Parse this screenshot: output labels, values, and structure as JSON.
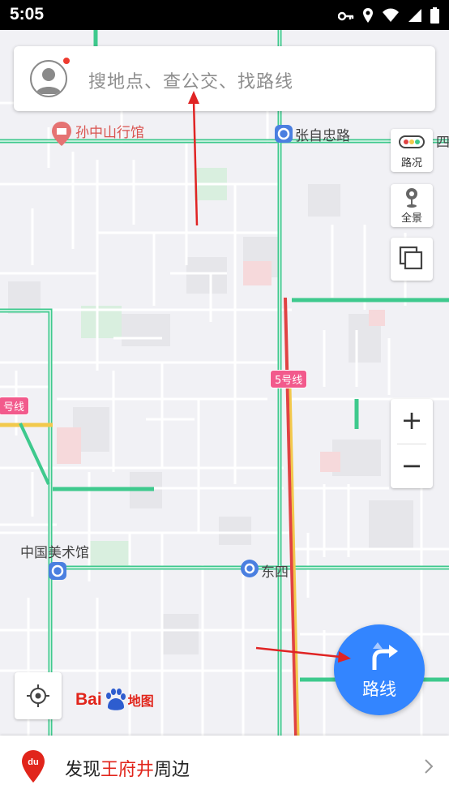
{
  "status_bar": {
    "time": "5:05",
    "icons": [
      "key-icon",
      "location-icon",
      "wifi-icon",
      "signal-icon",
      "battery-icon"
    ]
  },
  "search": {
    "placeholder": "搜地点、查公交、找路线",
    "has_notification_dot": true
  },
  "tools": {
    "traffic_label": "路况",
    "panorama_label": "全景",
    "layers_icon": "layers-icon"
  },
  "zoom": {
    "in_label": "+",
    "out_label": "−"
  },
  "map_labels": {
    "sun_yatsen": "孙中山行馆",
    "zhangzizhong": "张自忠路",
    "si": "四",
    "line5": "5号线",
    "line_left": "号线",
    "art_museum": "中国美术馆",
    "dongsi": "东四"
  },
  "route_button": {
    "label": "路线"
  },
  "logo": {
    "text_left": "Bai",
    "text_right": "地图"
  },
  "bottom_bar": {
    "prefix": "发现",
    "highlight": "王府井",
    "suffix": "周边"
  },
  "colors": {
    "accent_blue": "#3385ff",
    "highlight_red": "#e1251b",
    "road_green": "#3ec98d",
    "metro_pink": "#f25a8c"
  }
}
